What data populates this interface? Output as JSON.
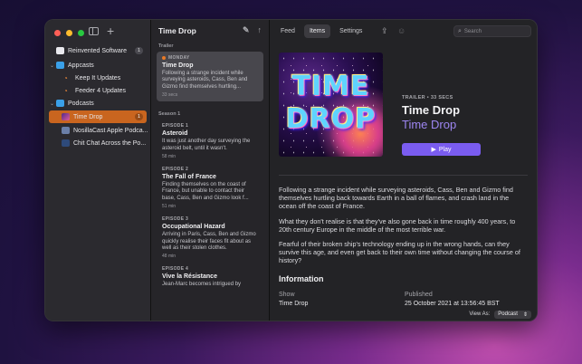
{
  "sidebar": {
    "items": [
      {
        "label": "Reinvented Software",
        "badge": "1"
      },
      {
        "label": "Appcasts"
      },
      {
        "label": "Keep It Updates"
      },
      {
        "label": "Feeder 4 Updates"
      },
      {
        "label": "Podcasts"
      },
      {
        "label": "Time Drop",
        "badge": "1"
      },
      {
        "label": "NosillaCast Apple Podca..."
      },
      {
        "label": "Chit Chat Across the Po..."
      }
    ]
  },
  "list": {
    "title": "Time Drop",
    "trailer_section": "Trailer",
    "season_section": "Season 1",
    "episodes": [
      {
        "kicker": "MONDAY",
        "title": "Time Drop",
        "desc": "Following a strange incident while surveying asteroids, Cass, Ben and Gizmo find themselves hurtling...",
        "dur": "33 secs"
      },
      {
        "kicker": "EPISODE 1",
        "title": "Asteroid",
        "desc": "It was just another day surveying the asteroid belt, until it wasn't.",
        "dur": "58 min"
      },
      {
        "kicker": "EPISODE 2",
        "title": "The Fall of France",
        "desc": "Finding themselves on the coast of France, but unable to contact their base, Cass, Ben and Gizmo look f...",
        "dur": "51 min"
      },
      {
        "kicker": "EPISODE 3",
        "title": "Occupational Hazard",
        "desc": "Arriving in Paris, Cass, Ben and Gizmo quickly realise their faces fit about as well as their stolen clothes.",
        "dur": "48 min"
      },
      {
        "kicker": "EPISODE 4",
        "title": "Vive la Résistance",
        "desc": "Jean-Marc becomes intrigued by",
        "dur": ""
      }
    ]
  },
  "detail": {
    "tabs": [
      "Feed",
      "Items",
      "Settings"
    ],
    "search_placeholder": "Search",
    "art_word1": "TIME",
    "art_word2": "DROP",
    "kicker": "TRAILER • 33 SECS",
    "title": "Time Drop",
    "show": "Time Drop",
    "play_label": "Play",
    "paragraphs": [
      "Following a strange incident while surveying asteroids, Cass, Ben and Gizmo find themselves hurtling back towards Earth in a ball of flames, and crash land in the ocean off the coast of France.",
      "What they don't realise is that they've also gone back in time roughly 400 years, to 20th century Europe in the middle of the most terrible war.",
      "Fearful of their broken ship's technology ending up in the wrong hands, can they survive this age, and even get back to their own time without changing the course of history?"
    ],
    "info_heading": "Information",
    "info_show_label": "Show",
    "info_show_value": "Time Drop",
    "info_published_label": "Published",
    "info_published_value": "25 October 2021 at 13:56:45 BST"
  },
  "footer": {
    "view_as_label": "View As:",
    "view_as_value": "Podcast"
  },
  "colors": {
    "accent": "#c9651f",
    "play": "#7a5cf0",
    "show_link": "#9d86f2"
  }
}
